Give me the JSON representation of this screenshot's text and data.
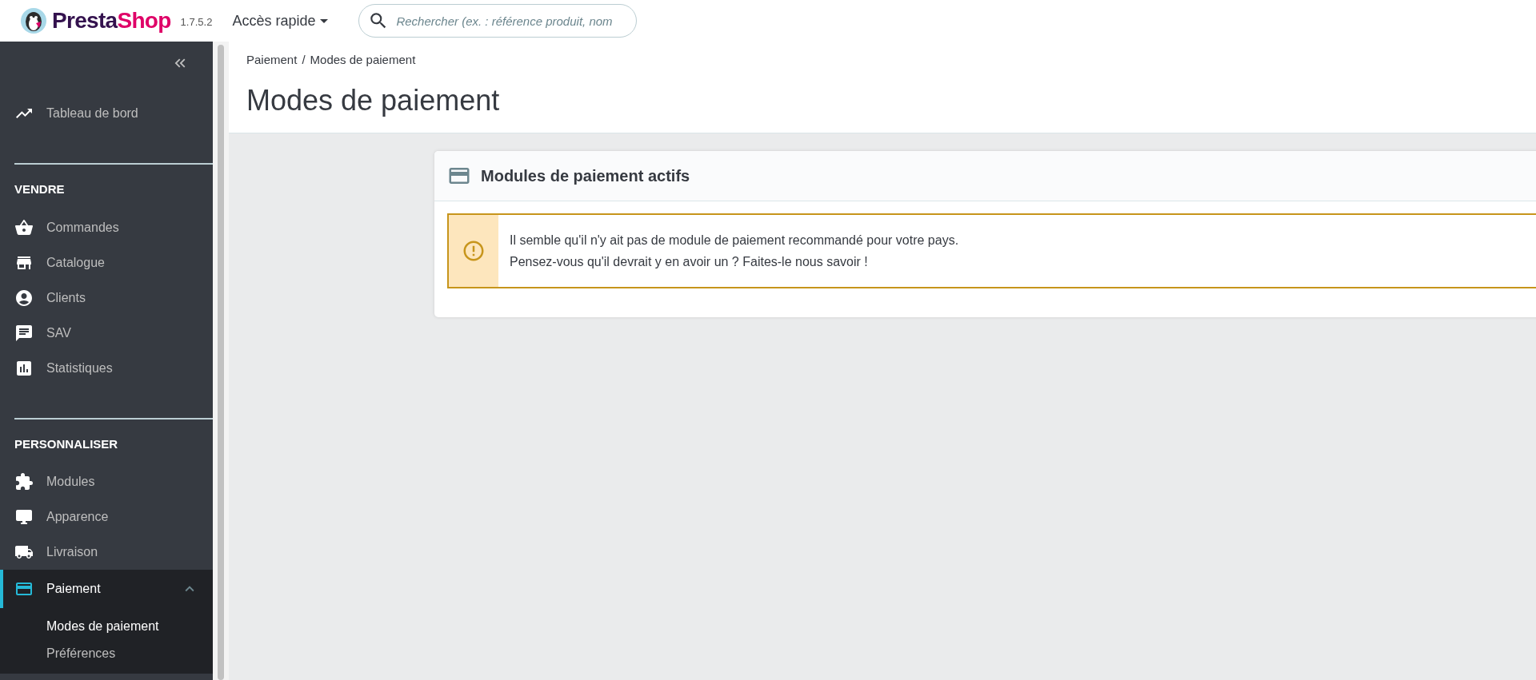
{
  "header": {
    "logo": {
      "parts": [
        "Presta",
        "Shop"
      ]
    },
    "version": "1.7.5.2",
    "quick_access": "Accès rapide",
    "search": {
      "placeholder": "Rechercher (ex. : référence produit, nom"
    }
  },
  "sidebar": {
    "items": [
      {
        "label": "Tableau de bord",
        "selected": false
      }
    ],
    "sections": [
      {
        "title": "VENDRE",
        "items": [
          {
            "label": "Commandes",
            "selected": false
          },
          {
            "label": "Catalogue",
            "selected": false
          },
          {
            "label": "Clients",
            "selected": false
          },
          {
            "label": "SAV",
            "selected": false
          },
          {
            "label": "Statistiques",
            "selected": false
          }
        ]
      },
      {
        "title": "PERSONNALISER",
        "items": [
          {
            "label": "Modules",
            "selected": false
          },
          {
            "label": "Apparence",
            "selected": false
          },
          {
            "label": "Livraison",
            "selected": false
          },
          {
            "label": "Paiement",
            "selected": true,
            "expanded": true,
            "children": [
              {
                "label": "Modes de paiement",
                "selected": true
              },
              {
                "label": "Préférences",
                "selected": false
              }
            ]
          }
        ]
      }
    ]
  },
  "breadcrumb": {
    "separator": "/",
    "items": [
      "Paiement",
      "Modes de paiement"
    ]
  },
  "page_title": "Modes de paiement",
  "panel": {
    "title": "Modules de paiement actifs",
    "alert": {
      "lines": [
        "Il semble qu'il n'y ait pas de module de paiement recommandé pour votre pays.",
        "Pensez-vous qu'il devrait y en avoir un ? Faites-le nous savoir !"
      ]
    }
  }
}
